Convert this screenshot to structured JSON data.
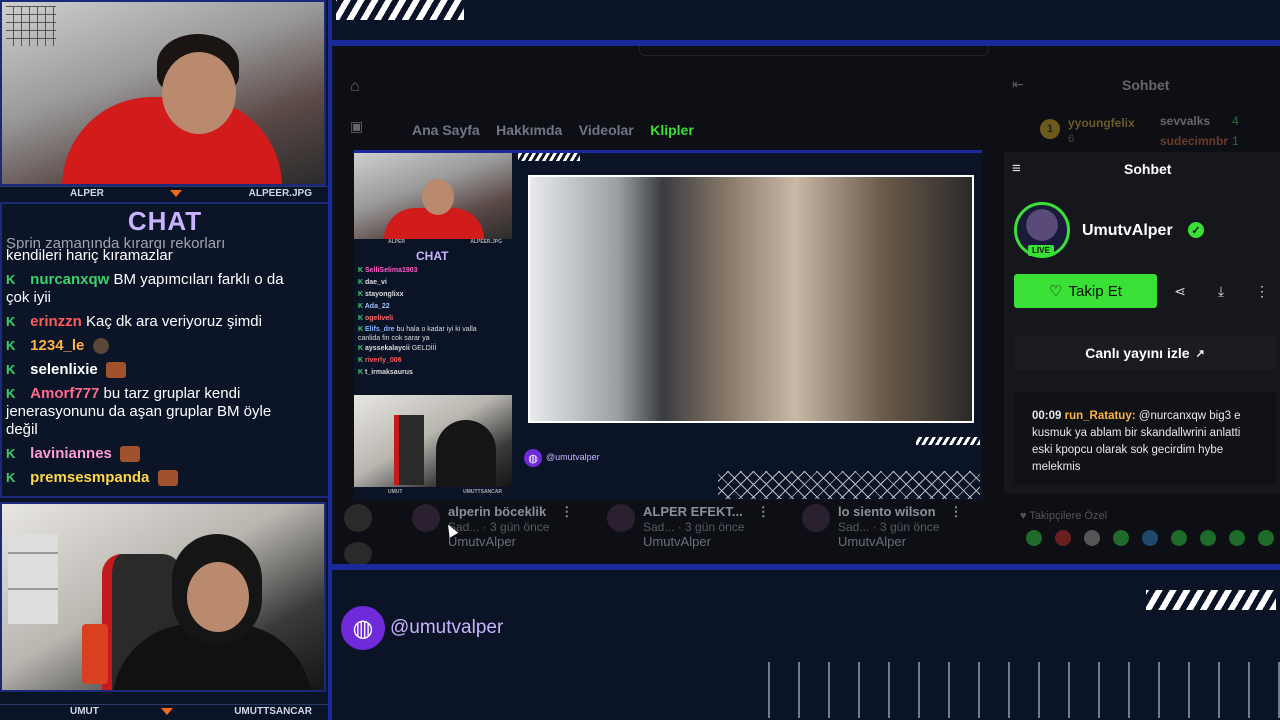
{
  "cam_top": {
    "left_name": "ALPER",
    "right_name": "ALPEER.JPG"
  },
  "cam_bottom": {
    "left_name": "UMUT",
    "right_name": "UMUTTSANCAR"
  },
  "chat": {
    "title": "CHAT",
    "top_fragment_1": "Şprin zamanında kırargı rekorları",
    "top_fragment_2": "kendileri hariç kıramazlar",
    "messages": [
      {
        "user": "nurcanxqw",
        "color": "#3ad36b",
        "text": "BM yapımcıları farklı o da",
        "cont": "çok iyii"
      },
      {
        "user": "erinzzn",
        "color": "#ff5a5a",
        "text": "Kaç dk ara veriyoruz şimdi"
      },
      {
        "user": "1234_le",
        "color": "#ffb347",
        "text": ""
      },
      {
        "user": "selenlixie",
        "color": "#ffffff",
        "text": ""
      },
      {
        "user": "Amorf777",
        "color": "#ff6b8a",
        "text": "bu tarz gruplar kendi",
        "cont": "jenerasyonunu da aşan gruplar BM öyle",
        "cont2": "değil"
      },
      {
        "user": "laviniannes",
        "color": "#ff9ad5",
        "text": ""
      },
      {
        "user": "premsesmpanda",
        "color": "#ffd84a",
        "text": ""
      }
    ]
  },
  "kick": {
    "nav": [
      "Ana Sayfa",
      "Hakkımda",
      "Videolar",
      "Klipler"
    ],
    "active_nav": "Klipler",
    "behind_chat": {
      "title": "Sohbet",
      "u1": "yyoungfelix",
      "u2": "sevvalks",
      "u3": "sudecimnbr",
      "n1": "4",
      "n2": "1",
      "rank": "1",
      "count": "6"
    },
    "sidebar": {
      "title": "Sohbet",
      "channel": "UmutvAlper",
      "live": "LIVE",
      "follow": "Takip Et",
      "watch_live": "Canlı yayını izle",
      "msg_time": "00:09",
      "msg_user": "run_Ratatuy:",
      "msg_text": "@nurcanxqw big3 e kusmuk ya ablam bir skandallwrini anlatti eski kpopcu olarak sok gecirdim hybe melekmis",
      "followers_only": "Takipçilere Özel"
    },
    "clips": [
      {
        "title": "alperin böceklik",
        "time": "3 gün önce",
        "author": "UmutvAlper"
      },
      {
        "title": "ALPER EFEKT...",
        "time": "3 gün önce",
        "author": "UmutvAlper"
      },
      {
        "title": "lo siento wilson",
        "time": "3 gün önce",
        "author": "UmutvAlper"
      }
    ],
    "mini": {
      "chat_title": "CHAT",
      "handle": "@umutvalper",
      "lines": [
        {
          "u": "SelliSelima1903",
          "c": "#ff5ac8",
          "t": ""
        },
        {
          "u": "dae_vi",
          "c": "#ffffff",
          "t": ""
        },
        {
          "u": "stayonglixx",
          "c": "#ffffff",
          "t": ""
        },
        {
          "u": "Ada_22",
          "c": "#a0c0ff",
          "t": ""
        },
        {
          "u": "ogeliveli",
          "c": "#ff6b6b",
          "t": ""
        },
        {
          "u": "Elifs_dre",
          "c": "#8ab4ff",
          "t": "bu hala o kadar iyi ki valla"
        },
        {
          "u": "",
          "c": "#ffffff",
          "t": "canlida fin cok sarar ya"
        },
        {
          "u": "ayssekalaycii",
          "c": "#ffffff",
          "t": "GELDİİİ"
        },
        {
          "u": "riverly_006",
          "c": "#ff5a5a",
          "t": ""
        },
        {
          "u": "t_irmaksaurus",
          "c": "#ffffff",
          "t": ""
        }
      ],
      "left_name": "ALPER",
      "right_name": "ALPEER.JPG",
      "b_left": "UMUT",
      "b_right": "UMUTTSANCAR"
    }
  },
  "footer": {
    "handle": "@umutvalper"
  }
}
